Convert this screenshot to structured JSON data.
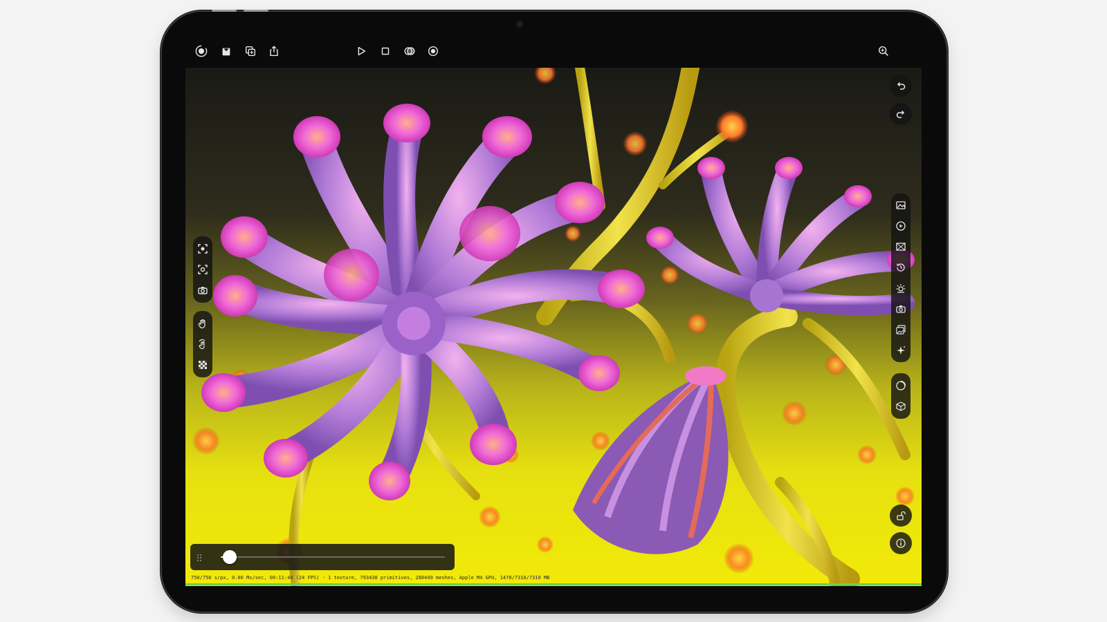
{
  "toolbar": {
    "left_tools": [
      {
        "id": "record",
        "icon": "record-icon"
      },
      {
        "id": "save",
        "icon": "save-icon"
      },
      {
        "id": "duplicate",
        "icon": "duplicate-icon"
      },
      {
        "id": "share",
        "icon": "share-icon"
      }
    ],
    "center_tools": [
      {
        "id": "play",
        "icon": "play-icon"
      },
      {
        "id": "stop",
        "icon": "stop-icon"
      },
      {
        "id": "view-mode",
        "icon": "view-mode-icon"
      },
      {
        "id": "target",
        "icon": "target-icon"
      }
    ],
    "right_tools": [
      {
        "id": "zoom",
        "icon": "zoom-icon"
      }
    ]
  },
  "history": {
    "undo_icon": "undo-icon",
    "redo_icon": "redo-icon"
  },
  "left_panel": {
    "group1": [
      "frame-select-icon",
      "focus-icon",
      "camera-icon"
    ],
    "group2": [
      "hand-icon",
      "rotate-hand-icon",
      "checkerboard-icon"
    ]
  },
  "right_panel": {
    "group1": [
      "image-icon",
      "play-circle-icon",
      "picture-icon",
      "history-icon",
      "sun-icon",
      "camera-icon",
      "gallery-icon",
      "sparkle-icon"
    ],
    "group2": [
      "sphere-icon",
      "cube-icon"
    ]
  },
  "bottom_right": {
    "lock_icon": "unlock-icon",
    "info_icon": "info-icon"
  },
  "timeline": {
    "progress": 0.04
  },
  "status_text": "750/750 s/px, 0.00 Ms/sec, 00:11:44 (24 FPS) - 1 texture, 793438 primitives, 280449 meshes, Apple M4 GPU, 1470/7310/7310 MB",
  "colors": {
    "bezel": "#0a0a0a",
    "panel_bg": "#141414",
    "accent_green": "#6bd14a",
    "icon": "#e6e6e6"
  }
}
